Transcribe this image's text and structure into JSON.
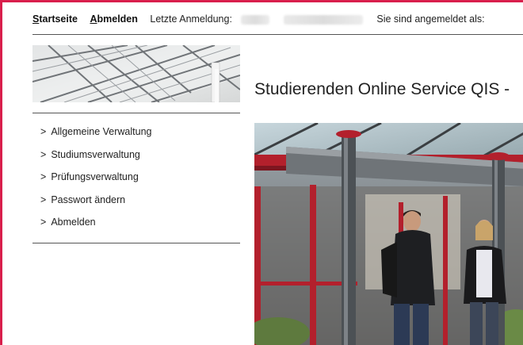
{
  "topbar": {
    "home_label": "Startseite",
    "logout_label": "Abmelden",
    "last_login_label": "Letzte Anmeldung:",
    "logged_in_label": "Sie sind angemeldet als:"
  },
  "sidebar": {
    "items": [
      {
        "label": "Allgemeine Verwaltung"
      },
      {
        "label": "Studiumsverwaltung"
      },
      {
        "label": "Prüfungsverwaltung"
      },
      {
        "label": "Passwort ändern"
      },
      {
        "label": "Abmelden"
      }
    ],
    "arrow": ">"
  },
  "main": {
    "title": "Studierenden Online Service QIS -"
  },
  "colors": {
    "frame": "#d91f4c"
  }
}
